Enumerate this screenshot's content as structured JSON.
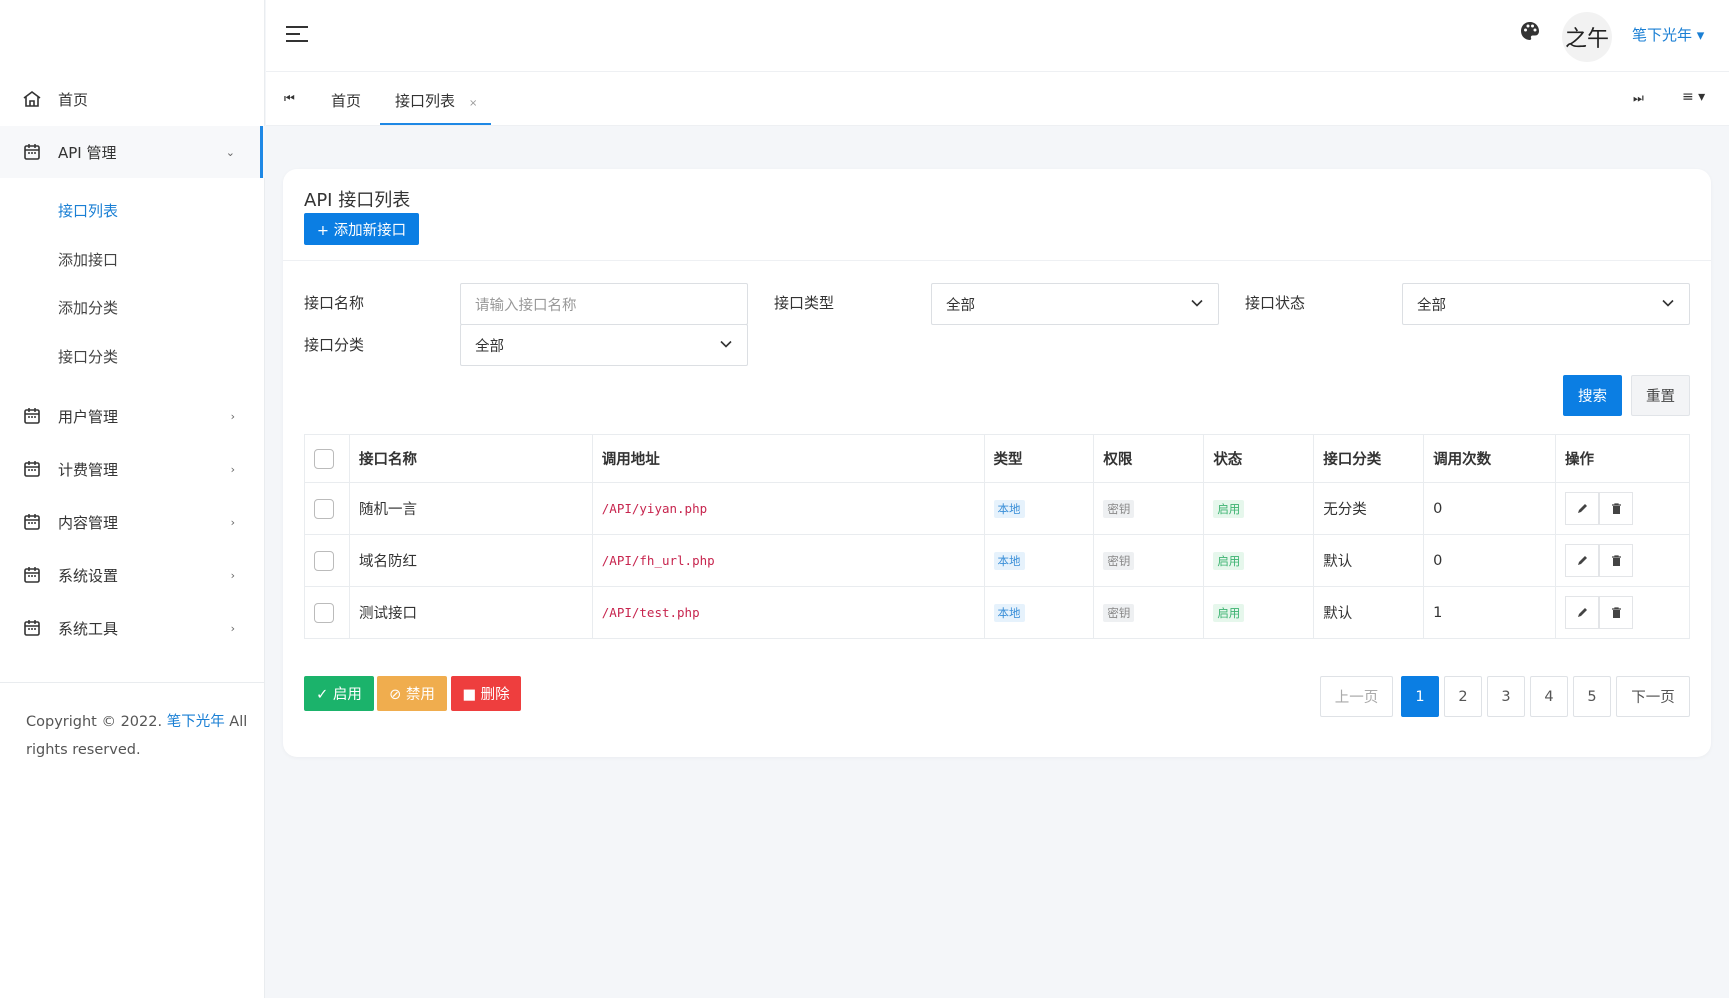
{
  "sidebar": {
    "items": [
      {
        "label": "首页",
        "icon": "home-icon"
      },
      {
        "label": "API 管理",
        "icon": "calendar-icon",
        "expanded": true
      },
      {
        "label": "用户管理",
        "icon": "calendar-icon"
      },
      {
        "label": "计费管理",
        "icon": "calendar-icon"
      },
      {
        "label": "内容管理",
        "icon": "calendar-icon"
      },
      {
        "label": "系统设置",
        "icon": "calendar-icon"
      },
      {
        "label": "系统工具",
        "icon": "calendar-icon"
      }
    ],
    "subitems": [
      {
        "label": "接口列表",
        "active": true
      },
      {
        "label": "添加接口"
      },
      {
        "label": "添加分类"
      },
      {
        "label": "接口分类"
      }
    ],
    "copyright_prefix": "Copyright © 2022. ",
    "copyright_brand": "笔下光年",
    "copyright_suffix": " All rights reserved."
  },
  "header": {
    "username": "笔下光年 ▾",
    "avatar_text": "之午"
  },
  "tabs": {
    "items": [
      {
        "label": "首页"
      },
      {
        "label": "接口列表",
        "active": true
      }
    ],
    "close_glyph": "×"
  },
  "card": {
    "title": "API 接口列表",
    "add_button": "+ 添加新接口"
  },
  "filters": {
    "name_label": "接口名称",
    "name_placeholder": "请输入接口名称",
    "type_label": "接口类型",
    "type_value": "全部",
    "status_label": "接口状态",
    "status_value": "全部",
    "category_label": "接口分类",
    "category_value": "全部",
    "search_button": "搜索",
    "reset_button": "重置"
  },
  "table": {
    "headers": [
      "接口名称",
      "调用地址",
      "类型",
      "权限",
      "状态",
      "接口分类",
      "调用次数",
      "操作"
    ],
    "rows": [
      {
        "name": "随机一言",
        "url": "/API/yiyan.php",
        "type": "本地",
        "perm": "密钥",
        "status": "启用",
        "category": "无分类",
        "calls": "0"
      },
      {
        "name": "域名防红",
        "url": "/API/fh_url.php",
        "type": "本地",
        "perm": "密钥",
        "status": "启用",
        "category": "默认",
        "calls": "0"
      },
      {
        "name": "测试接口",
        "url": "/API/test.php",
        "type": "本地",
        "perm": "密钥",
        "status": "启用",
        "category": "默认",
        "calls": "1"
      }
    ]
  },
  "bulk_actions": {
    "enable": "✓ 启用",
    "disable": "⊘ 禁用",
    "delete": "■ 删除"
  },
  "pagination": {
    "prev": "上一页",
    "pages": [
      "1",
      "2",
      "3",
      "4",
      "5"
    ],
    "current": "1",
    "next": "下一页"
  },
  "colors": {
    "accent": "#0b7ee3",
    "success": "#1bb36b",
    "warning": "#f0ad4e",
    "danger": "#ee3e3e"
  }
}
